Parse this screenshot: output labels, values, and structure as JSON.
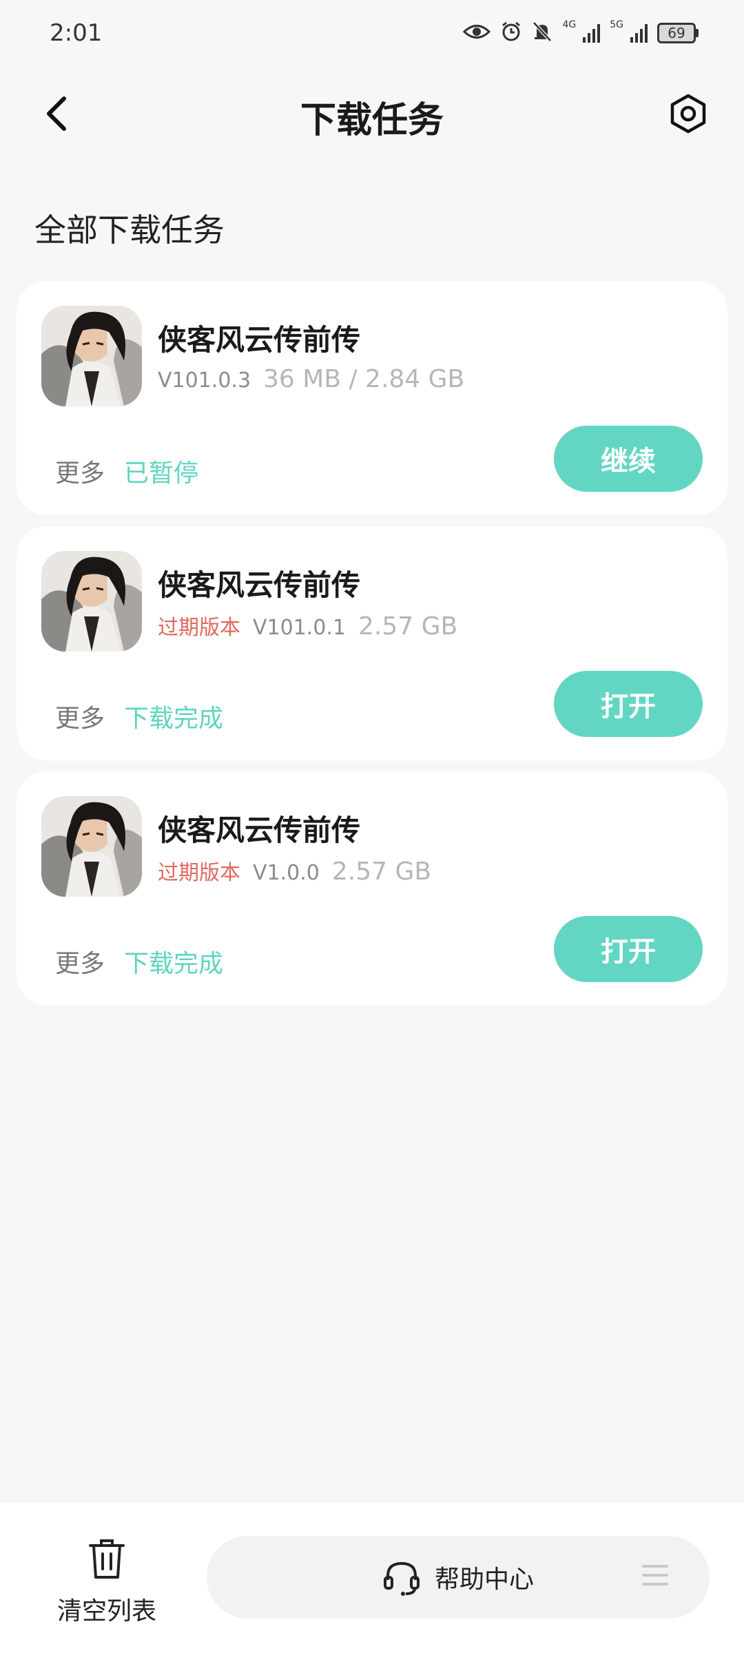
{
  "status_bar": {
    "time": "2:01",
    "network_1": "4G",
    "network_2": "5G",
    "battery": "69"
  },
  "header": {
    "title": "下载任务",
    "back_icon": "chevron-left-icon",
    "settings_icon": "hexagon-gear-icon"
  },
  "section_title": "全部下载任务",
  "colors": {
    "accent": "#62d6c3",
    "status_text": "#5fd4c0",
    "outdated": "#e0685e",
    "background": "#f6f7f9"
  },
  "tasks": [
    {
      "name": "侠客风云传前传",
      "outdated_label": "",
      "version": "V101.0.3",
      "size": "36 MB / 2.84 GB",
      "more": "更多",
      "state": "已暂停",
      "action": "继续"
    },
    {
      "name": "侠客风云传前传",
      "outdated_label": "过期版本",
      "version": "V101.0.1",
      "size": "2.57 GB",
      "more": "更多",
      "state": "下载完成",
      "action": "打开"
    },
    {
      "name": "侠客风云传前传",
      "outdated_label": "过期版本",
      "version": "V1.0.0",
      "size": "2.57 GB",
      "more": "更多",
      "state": "下载完成",
      "action": "打开"
    }
  ],
  "bottom_bar": {
    "clear_label": "清空列表",
    "help_label": "帮助中心"
  }
}
